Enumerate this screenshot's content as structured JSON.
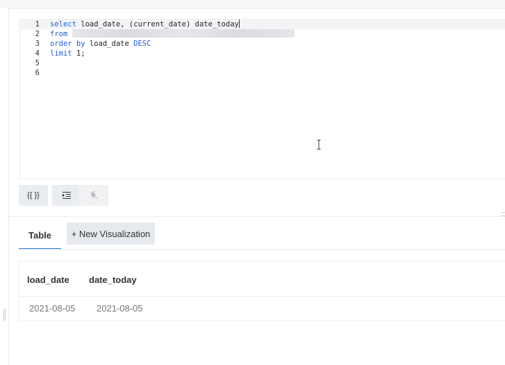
{
  "editor": {
    "lines": [
      {
        "num": "1",
        "active": true,
        "parts": [
          {
            "t": "select",
            "kw": true
          },
          {
            "t": " load_date, (current_date) date_today",
            "kw": false
          }
        ],
        "cursor": true
      },
      {
        "num": "2",
        "active": false,
        "parts": [
          {
            "t": "from",
            "kw": true
          },
          {
            "t": " ",
            "kw": false
          }
        ],
        "redacted": true
      },
      {
        "num": "3",
        "active": false,
        "parts": [
          {
            "t": "order by",
            "kw": true
          },
          {
            "t": " load_date ",
            "kw": false
          },
          {
            "t": "DESC",
            "kw": true
          }
        ]
      },
      {
        "num": "4",
        "active": false,
        "parts": [
          {
            "t": "limit",
            "kw": true
          },
          {
            "t": " 1;",
            "kw": false
          }
        ]
      },
      {
        "num": "5",
        "active": false,
        "parts": []
      },
      {
        "num": "6",
        "active": false,
        "parts": []
      }
    ]
  },
  "toolbar": {
    "format_label": "{{ }}",
    "indent_icon": "indent-icon",
    "autocomplete_icon": "autocomplete-off-icon"
  },
  "tabs": {
    "table_label": "Table",
    "new_visualization_label": "+ New Visualization"
  },
  "results": {
    "columns": [
      "load_date",
      "date_today"
    ],
    "rows": [
      [
        "2021-08-05",
        "2021-08-05"
      ]
    ]
  },
  "colors": {
    "keyword": "#1f5fd6",
    "active_tab_underline": "#2a7be4"
  }
}
